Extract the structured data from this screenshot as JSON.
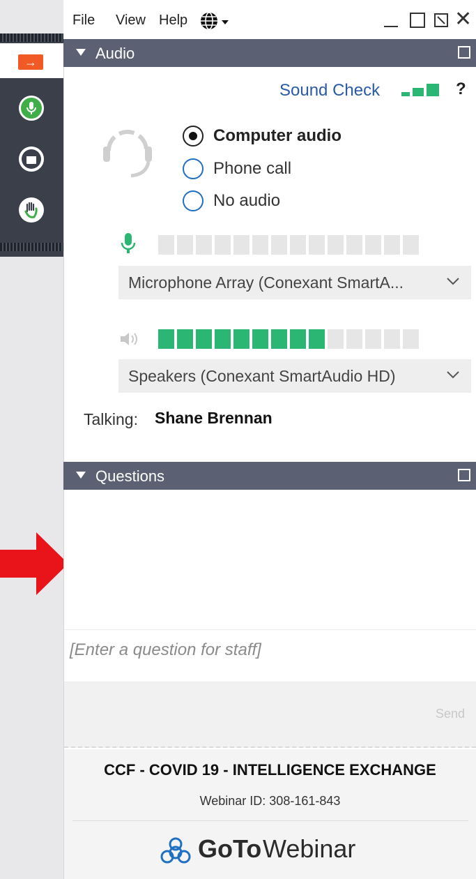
{
  "menu": {
    "file": "File",
    "view": "View",
    "help": "Help"
  },
  "sidebar": {
    "icons": [
      "arrow-right-icon",
      "microphone-icon",
      "window-icon",
      "raise-hand-icon"
    ],
    "arrow_symbol": "→",
    "accent": "#f15a24",
    "mic_color": "#3fae49"
  },
  "audio": {
    "header": "Audio",
    "sound_check": "Sound Check",
    "help_symbol": "?",
    "options": [
      {
        "label": "Computer audio",
        "selected": true
      },
      {
        "label": "Phone call",
        "selected": false
      },
      {
        "label": "No audio",
        "selected": false
      }
    ],
    "microphone": {
      "device": "Microphone Array (Conexant SmartA...",
      "level_segments_on": 0,
      "level_segments_total": 14
    },
    "speakers": {
      "device": "Speakers (Conexant SmartAudio HD)",
      "level_segments_on": 9,
      "level_segments_total": 14
    },
    "talking_label": "Talking:",
    "talking_name": "Shane Brennan"
  },
  "questions": {
    "header": "Questions",
    "placeholder": "[Enter a question for staff]",
    "send_label": "Send"
  },
  "footer": {
    "webinar_title": "CCF - COVID 19 - INTELLIGENCE EXCHANGE",
    "webinar_id": "Webinar ID: 308-161-843",
    "brand_bold": "GoTo",
    "brand_light": "Webinar"
  },
  "colors": {
    "header_bg": "#5b6172",
    "link_blue": "#2a5aa8",
    "meter_on": "#2bb673",
    "annotation_arrow": "#e8141a"
  }
}
